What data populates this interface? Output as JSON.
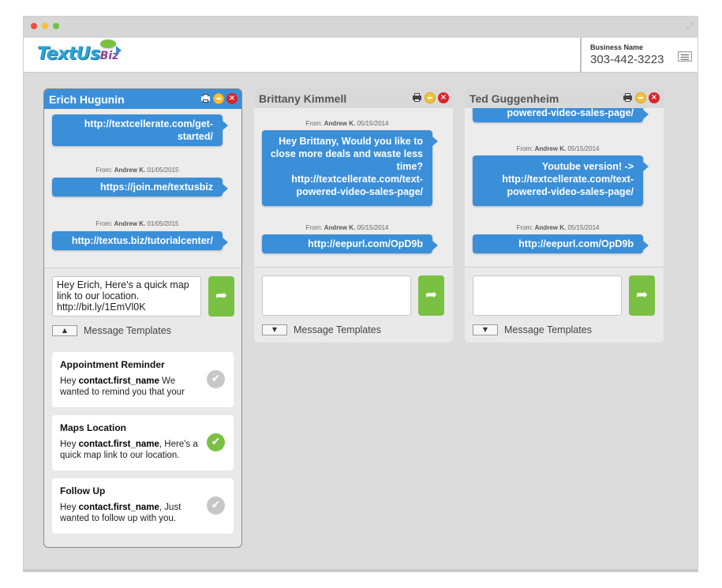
{
  "app": {
    "logo_text": "TextUs",
    "logo_suffix": "Biz",
    "logo_tm": "TM",
    "business_label": "Business Name",
    "business_phone": "303-442-3223"
  },
  "panels": [
    {
      "contact": "Erich Hugunin",
      "messages": [
        {
          "from_label": "From:",
          "from": "Andrew K.",
          "date": "01/05/2015",
          "text": "http://textcellerate.com/get-started/"
        },
        {
          "from_label": "From:",
          "from": "Andrew K.",
          "date": "01/05/2015",
          "text": "https://join.me/textusbiz"
        },
        {
          "from_label": "From:",
          "from": "Andrew K.",
          "date": "01/05/2015",
          "text": "http://textus.biz/tutorialcenter/"
        }
      ],
      "draft": "Hey Erich, Here's a quick map link to our location. http://bit.ly/1EmVl0K",
      "templates_label": "Message Templates",
      "templates": [
        {
          "title": "Appointment Reminder",
          "greeting": "Hey",
          "token": "contact.first_name",
          "body": " We wanted to remind you that your",
          "selected": false
        },
        {
          "title": "Maps Location",
          "greeting": "Hey",
          "token": "contact.first_name",
          "body": ", Here's a quick map link to our location.",
          "selected": true
        },
        {
          "title": "Follow Up",
          "greeting": "Hey",
          "token": "contact.first_name",
          "body": ", Just wanted to follow up with you.",
          "selected": false
        }
      ]
    },
    {
      "contact": "Brittany Kimmell",
      "messages": [
        {
          "from_label": "From:",
          "from": "Andrew K.",
          "date": "05/15/2014",
          "text": "Hey Brittany, Would you like to close more deals and waste less time? http://textcellerate.com/text-powered-video-sales-page/"
        },
        {
          "from_label": "From:",
          "from": "Andrew K.",
          "date": "05/15/2014",
          "text": "http://eepurl.com/OpD9b"
        }
      ],
      "draft": "",
      "templates_label": "Message Templates"
    },
    {
      "contact": "Ted Guggenheim",
      "messages": [
        {
          "text": "powered-video-sales-page/"
        },
        {
          "from_label": "From:",
          "from": "Andrew K.",
          "date": "05/15/2014",
          "text": "Youtube version! -> http://textcellerate.com/text-powered-video-sales-page/"
        },
        {
          "from_label": "From:",
          "from": "Andrew K.",
          "date": "05/15/2014",
          "text": "http://eepurl.com/OpD9b"
        }
      ],
      "draft": "",
      "templates_label": "Message Templates"
    }
  ]
}
